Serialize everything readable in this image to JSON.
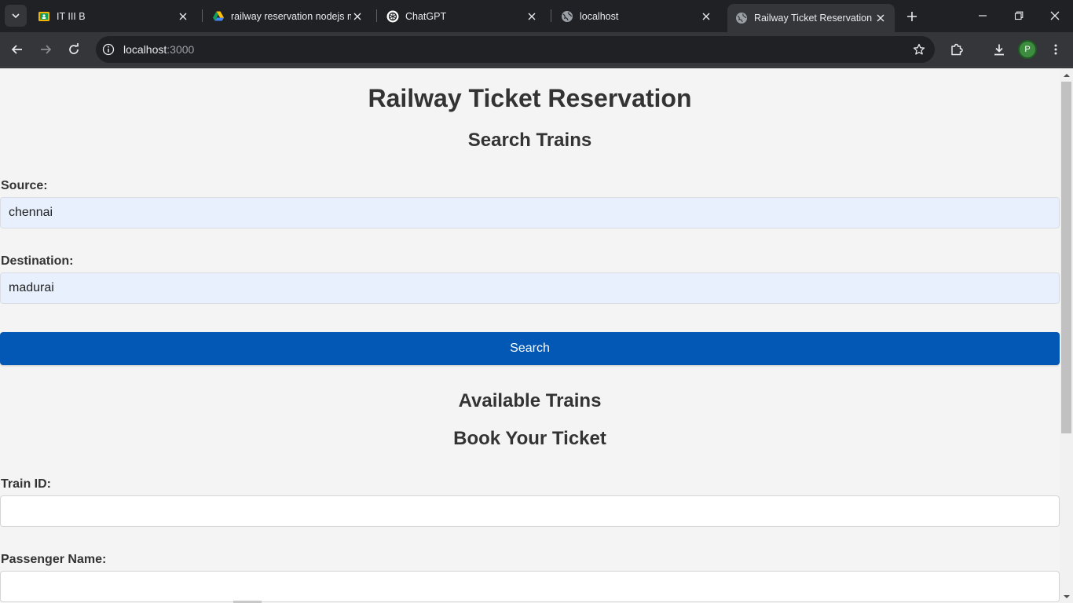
{
  "tabs": [
    {
      "title": "IT III B",
      "icon": "google-classroom-icon"
    },
    {
      "title": "railway reservation nodejs m",
      "icon": "google-drive-icon"
    },
    {
      "title": "ChatGPT",
      "icon": "chatgpt-icon"
    },
    {
      "title": "localhost",
      "icon": "globe-icon"
    },
    {
      "title": "Railway Ticket Reservation",
      "icon": "globe-icon",
      "active": true
    }
  ],
  "toolbar": {
    "url_host": "localhost",
    "url_port": ":3000",
    "profile_initial": "P"
  },
  "page": {
    "title": "Railway Ticket Reservation",
    "search_heading": "Search Trains",
    "source_label": "Source:",
    "source_value": "chennai",
    "destination_label": "Destination:",
    "destination_value": "madurai",
    "search_button": "Search",
    "available_heading": "Available Trains",
    "book_heading": "Book Your Ticket",
    "train_id_label": "Train ID:",
    "train_id_value": "",
    "passenger_label": "Passenger Name:",
    "passenger_value": ""
  },
  "colors": {
    "accent": "#0258b4",
    "page_bg": "#f4f4f4",
    "autofill_bg": "#e8f0fe"
  }
}
